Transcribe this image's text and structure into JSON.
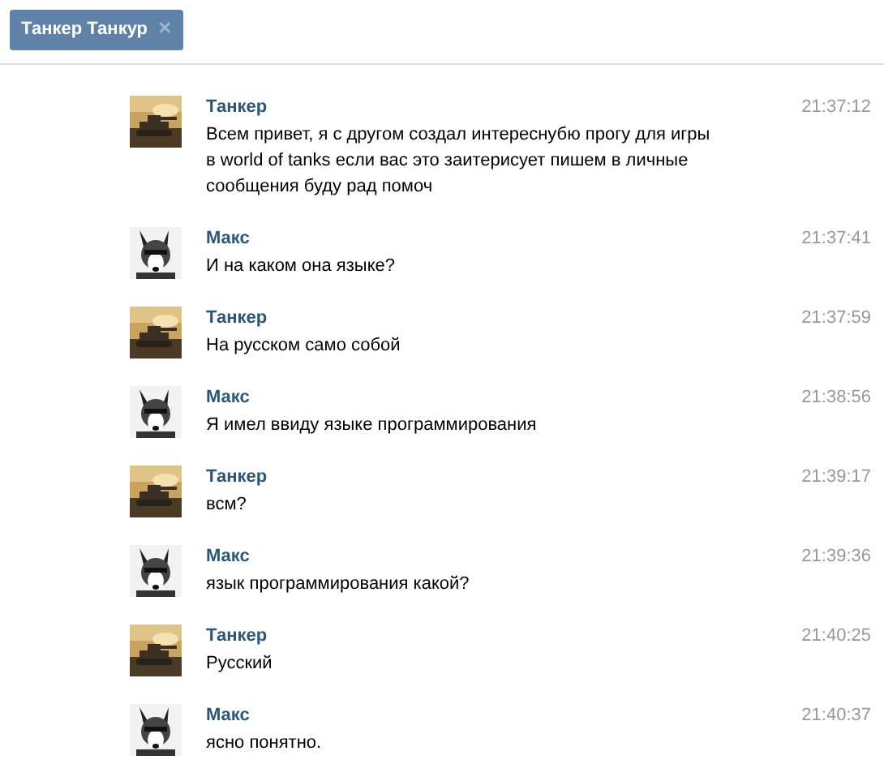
{
  "tab": {
    "label": "Танкер Танкур",
    "close": "✕"
  },
  "messages": [
    {
      "kind": "tank",
      "author": "Танкер",
      "time": "21:37:12",
      "text": "Всем привет, я с другом создал интереснубю прогу для игры в world of tanks если вас это заитерисует пишем в личные сообщения буду рад помоч"
    },
    {
      "kind": "dog",
      "author": "Макс",
      "time": "21:37:41",
      "text": "И на каком она языке?"
    },
    {
      "kind": "tank",
      "author": "Танкер",
      "time": "21:37:59",
      "text": "На русском само собой"
    },
    {
      "kind": "dog",
      "author": "Макс",
      "time": "21:38:56",
      "text": "Я имел ввиду языке программирования"
    },
    {
      "kind": "tank",
      "author": "Танкер",
      "time": "21:39:17",
      "text": "всм?"
    },
    {
      "kind": "dog",
      "author": "Макс",
      "time": "21:39:36",
      "text": "язык программирования какой?"
    },
    {
      "kind": "tank",
      "author": "Танкер",
      "time": "21:40:25",
      "text": "Русский"
    },
    {
      "kind": "dog",
      "author": "Макс",
      "time": "21:40:37",
      "text": "ясно понятно."
    }
  ]
}
